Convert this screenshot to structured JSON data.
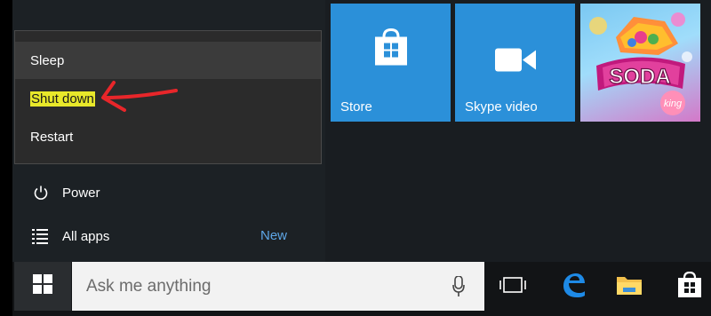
{
  "power_menu": {
    "items": [
      {
        "label": "Sleep"
      },
      {
        "label": "Shut down"
      },
      {
        "label": "Restart"
      }
    ]
  },
  "start_menu": {
    "power_label": "Power",
    "all_apps_label": "All apps",
    "new_badge": "New"
  },
  "tiles": [
    {
      "label": "Store",
      "icon": "store-icon"
    },
    {
      "label": "Skype video",
      "icon": "video-camera-icon"
    },
    {
      "label": "",
      "icon": "candy-crush-soda-tile",
      "logo_text": "SODA",
      "logo_subtext": "king"
    }
  ],
  "taskbar": {
    "search_placeholder": "Ask me anything",
    "icons": [
      "windows-start-icon",
      "microphone-icon",
      "task-view-icon",
      "edge-icon",
      "file-explorer-icon",
      "store-icon"
    ]
  },
  "colors": {
    "accent": "#2b90d9",
    "highlight": "#e8e82a",
    "annotation_arrow": "#e8262a",
    "new_badge": "#5ea6e6"
  }
}
